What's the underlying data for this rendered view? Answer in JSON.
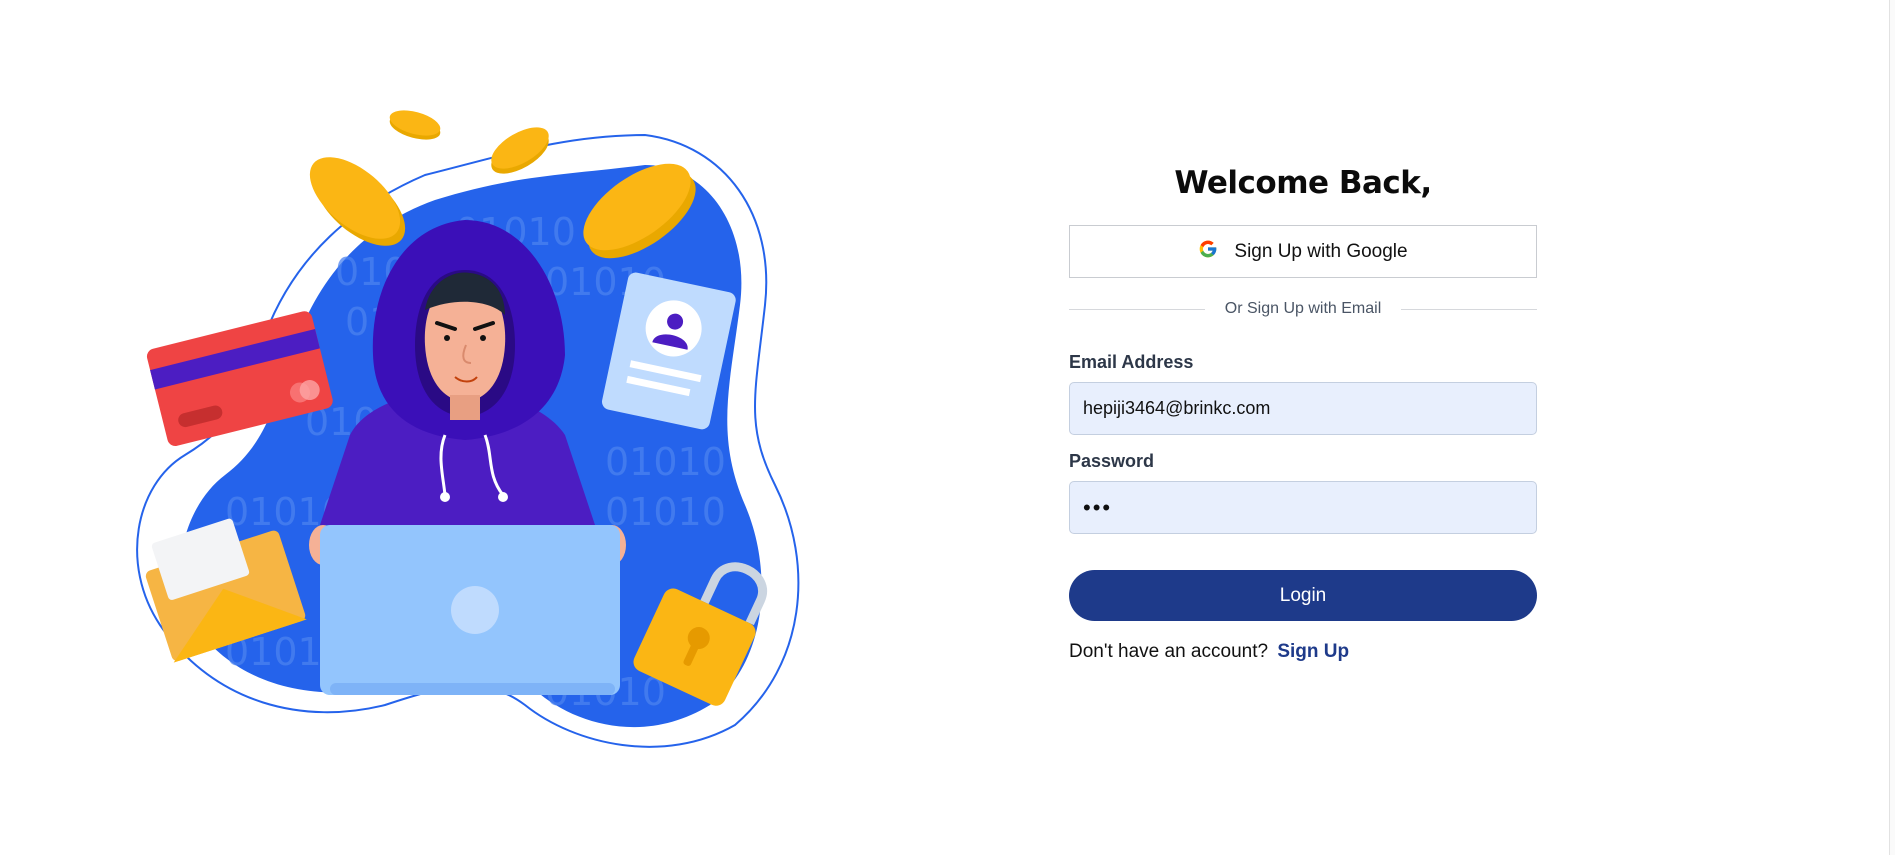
{
  "login": {
    "title": "Welcome Back,",
    "google_button_label": "Sign Up with Google",
    "divider_text": "Or Sign Up with Email",
    "email_label": "Email Address",
    "email_value": "hepiji3464@brinkc.com",
    "password_label": "Password",
    "password_value": "•••",
    "login_button_label": "Login",
    "no_account_text": "Don't have an account?",
    "signup_link_label": "Sign Up"
  },
  "illustration": {
    "binary_text": "01010"
  },
  "colors": {
    "primary": "#1e3a8a",
    "input_bg": "#e8effd",
    "blob_blue": "#2563eb",
    "coin_gold": "#fbb614"
  },
  "icons": [
    "google-icon"
  ]
}
